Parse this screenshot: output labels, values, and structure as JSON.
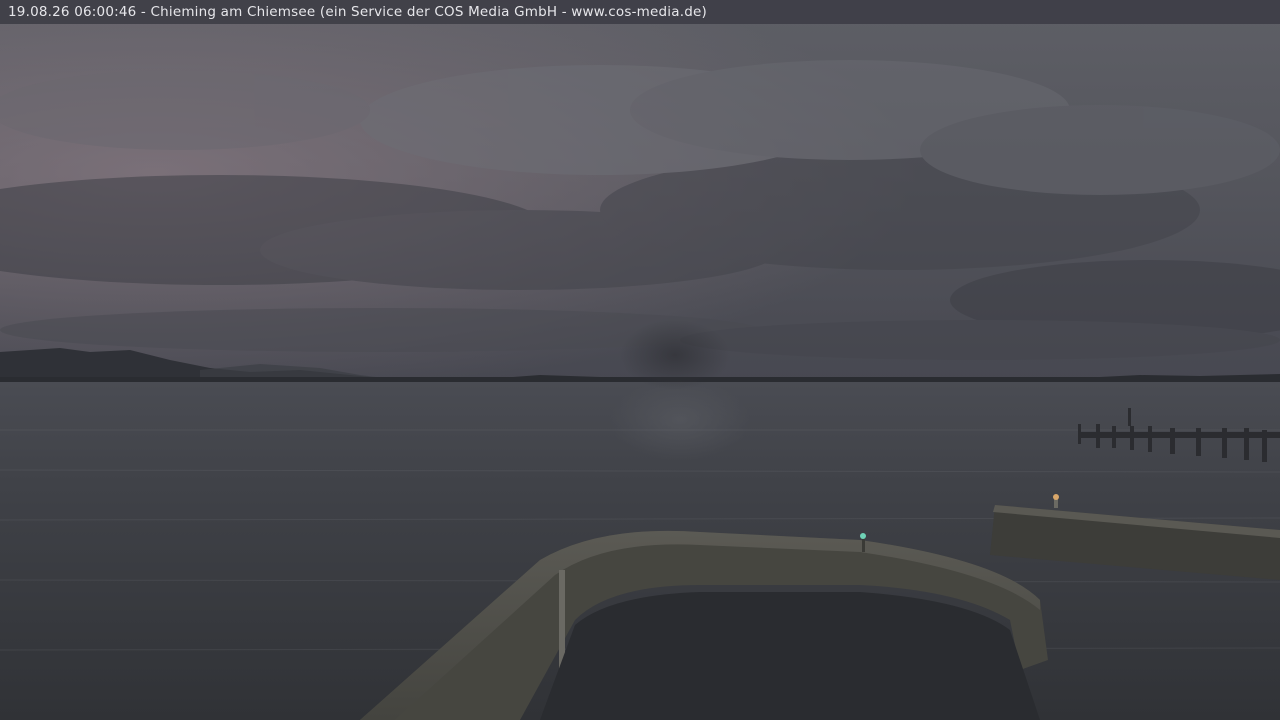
{
  "overlay": {
    "caption": "19.08.26 06:00:46 - Chieming am Chiemsee (ein Service der COS Media GmbH - www.cos-media.de)"
  },
  "scene": {
    "sky_color": "#5b5c63",
    "sky_pink_tint": "#7c7078",
    "water_color": "#3b3d42",
    "pier_color": "#4d4d48",
    "mountain_color": "#2e3036"
  }
}
